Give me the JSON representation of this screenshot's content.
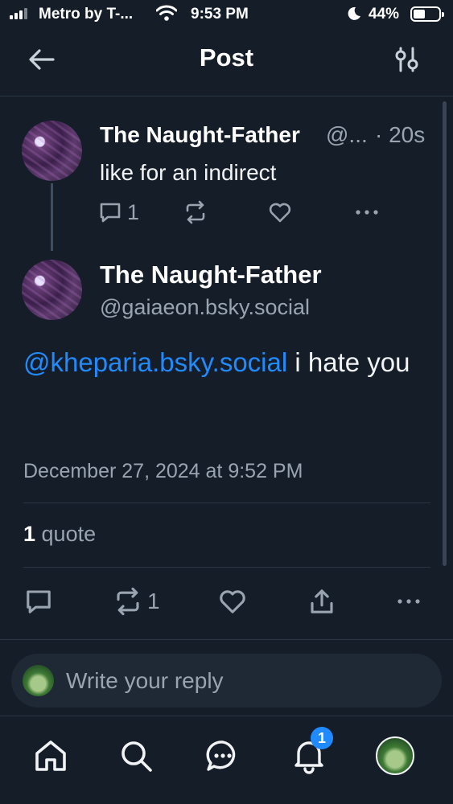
{
  "status_bar": {
    "carrier": "Metro by T-...",
    "time": "9:53 PM",
    "battery_percent": "44%",
    "icons": [
      "signal-icon",
      "wifi-icon",
      "moon-icon",
      "battery-icon"
    ]
  },
  "header": {
    "title": "Post",
    "icons": [
      "back-arrow-icon",
      "filter-sliders-icon"
    ]
  },
  "parent_post": {
    "author_name": "The Naught-Father",
    "handle_truncated": "@...",
    "timestamp": "· 20s",
    "text": "like for an indirect",
    "reply_count": "1",
    "icons": [
      "reply-icon",
      "repost-icon",
      "like-icon",
      "more-icon"
    ]
  },
  "main_post": {
    "author_name": "The Naught-Father",
    "handle": "@gaiaeon.bsky.social",
    "mention": "@kheparia.bsky.social",
    "text_rest": " i hate you",
    "date": "December 27, 2024 at 9:52 PM",
    "quote_count": "1",
    "quote_label": " quote",
    "repost_count": "1",
    "icons": [
      "reply-icon",
      "repost-icon",
      "like-icon",
      "share-icon",
      "more-icon"
    ]
  },
  "reply_bar": {
    "placeholder": "Write your reply"
  },
  "tab_bar": {
    "tabs": [
      "home-icon",
      "search-icon",
      "chat-icon",
      "notifications-icon",
      "profile-avatar"
    ],
    "notifications_badge": "1"
  },
  "colors": {
    "background": "#151d28",
    "accent": "#208bfe",
    "muted_text": "#9aa4b1"
  }
}
